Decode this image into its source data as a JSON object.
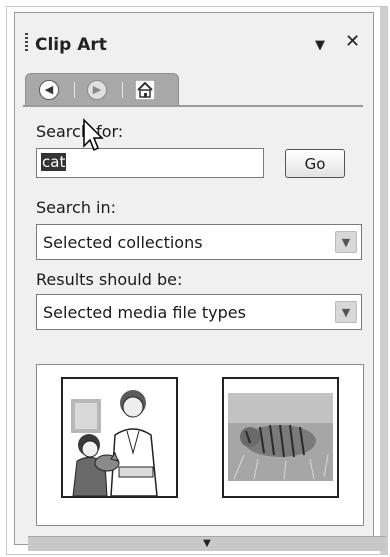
{
  "pane": {
    "title": "Clip Art",
    "dropdown_icon": "triangle-down",
    "close_icon": "close-x"
  },
  "nav": {
    "back_icon": "back-arrow-circle",
    "forward_icon": "forward-arrow-circle",
    "home_icon": "home-icon"
  },
  "search": {
    "label": "Search for:",
    "value": "cat",
    "go_label": "Go"
  },
  "search_in": {
    "label": "Search in:",
    "selected": "Selected collections"
  },
  "results_type": {
    "label": "Results should be:",
    "selected": "Selected media file types"
  },
  "results": {
    "items": [
      {
        "icon": "veterinarian-with-cat-clipart"
      },
      {
        "icon": "tiger-photo-clipart"
      }
    ]
  },
  "scroll": {
    "icon": "scroll-down-arrow"
  }
}
